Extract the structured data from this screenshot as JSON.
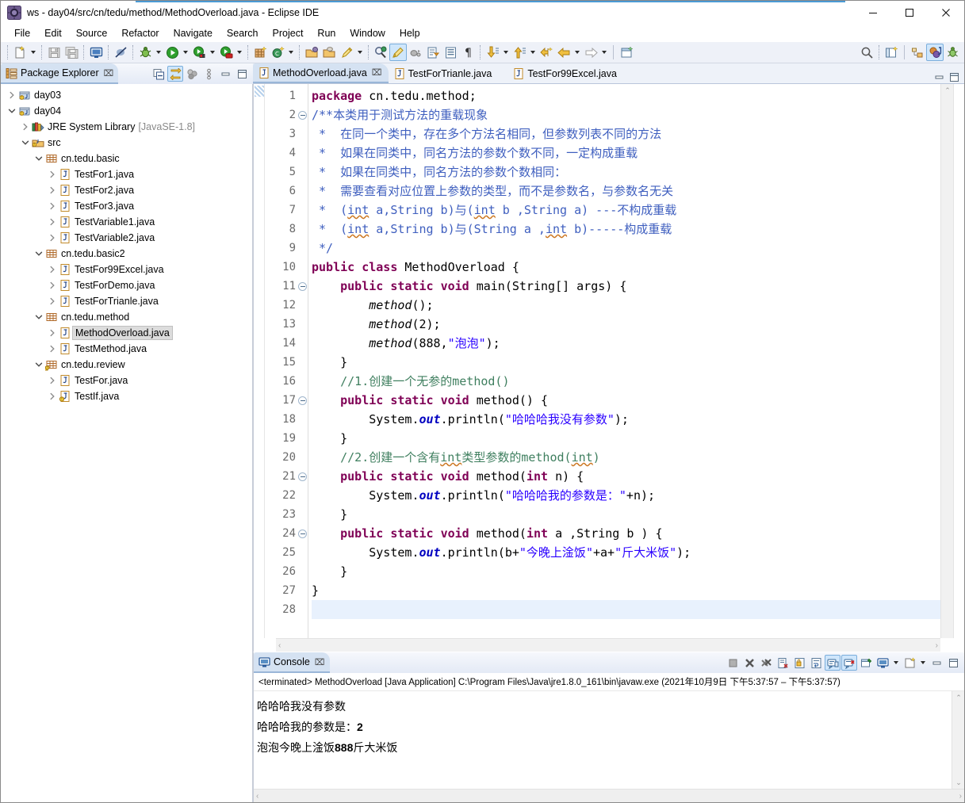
{
  "window": {
    "title": "ws - day04/src/cn/tedu/method/MethodOverload.java - Eclipse IDE",
    "app_icon": "eclipse-icon",
    "minimize_label": "—",
    "maximize_label": "□",
    "close_label": "✕",
    "accent_color": "#4a9ad4"
  },
  "menubar": {
    "items": [
      {
        "label": "File"
      },
      {
        "label": "Edit"
      },
      {
        "label": "Source"
      },
      {
        "label": "Refactor"
      },
      {
        "label": "Navigate"
      },
      {
        "label": "Search"
      },
      {
        "label": "Project"
      },
      {
        "label": "Run"
      },
      {
        "label": "Window"
      },
      {
        "label": "Help"
      }
    ]
  },
  "toolbar": {
    "groups": [
      {
        "items": [
          {
            "icon": "new-wizard-icon",
            "dropdown": true
          },
          {
            "icon": "save-icon",
            "dropdown": false
          },
          {
            "icon": "save-all-icon",
            "dropdown": false
          }
        ]
      },
      {
        "items": [
          {
            "icon": "print-icon",
            "dropdown": false
          }
        ]
      },
      {
        "items": [
          {
            "icon": "toggle-breakpoint-icon",
            "dropdown": false
          }
        ]
      },
      {
        "items": [
          {
            "icon": "debug-icon",
            "dropdown": true
          },
          {
            "icon": "run-icon",
            "dropdown": true
          },
          {
            "icon": "run-external-tools-icon",
            "dropdown": true
          },
          {
            "icon": "coverage-icon",
            "dropdown": true
          }
        ]
      },
      {
        "items": [
          {
            "icon": "new-java-package-icon",
            "dropdown": false
          },
          {
            "icon": "new-java-class-icon",
            "dropdown": true
          }
        ]
      },
      {
        "items": [
          {
            "icon": "open-type-icon",
            "dropdown": false
          },
          {
            "icon": "open-task-icon",
            "dropdown": false
          },
          {
            "icon": "quick-fix-icon",
            "dropdown": true
          }
        ]
      },
      {
        "items": [
          {
            "icon": "search-type-icon",
            "dropdown": false
          },
          {
            "icon": "highlight-marker-icon",
            "dropdown": false,
            "selected": true
          },
          {
            "icon": "skip-breakpoints-icon",
            "dropdown": false
          },
          {
            "icon": "new-annotation-icon",
            "dropdown": false
          },
          {
            "icon": "show-whitespace-icon",
            "dropdown": false
          },
          {
            "icon": "pilcrow-icon",
            "dropdown": false
          }
        ]
      },
      {
        "items": [
          {
            "icon": "next-annotation-icon",
            "dropdown": true
          },
          {
            "icon": "previous-annotation-icon",
            "dropdown": true
          },
          {
            "icon": "back-history-icon",
            "dropdown": false
          },
          {
            "icon": "back-arrow-icon",
            "dropdown": true
          },
          {
            "icon": "forward-arrow-icon",
            "dropdown": true
          }
        ]
      },
      {
        "items": [
          {
            "icon": "new-editor-icon",
            "dropdown": false
          }
        ]
      }
    ],
    "right_items": [
      {
        "icon": "search-icon"
      },
      {
        "icon": "open-perspective-icon"
      },
      {
        "icon": "java-browsing-perspective-icon"
      },
      {
        "icon": "java-perspective-icon",
        "selected": true
      },
      {
        "icon": "debug-perspective-icon"
      }
    ]
  },
  "package_explorer": {
    "title": "Package Explorer",
    "tab_icon": "package-explorer-icon",
    "close_icon": "⌧",
    "tools": [
      {
        "icon": "collapse-all-icon",
        "selected": false
      },
      {
        "icon": "link-with-editor-icon",
        "selected": true
      },
      {
        "icon": "view-menu-dots-icon",
        "selected": false
      },
      {
        "icon": "view-menu-icon",
        "selected": false
      },
      {
        "icon": "minimize-view-icon",
        "selected": false
      },
      {
        "icon": "maximize-view-icon",
        "selected": false
      }
    ],
    "tree": [
      {
        "label": "day03",
        "indent": 0,
        "icon": "java-project-icon",
        "twisty": "collapsed",
        "selected": false
      },
      {
        "label": "day04",
        "indent": 0,
        "icon": "java-project-icon",
        "twisty": "expanded",
        "selected": false
      },
      {
        "label": "JRE System Library",
        "indent": 1,
        "icon": "jre-library-icon",
        "twisty": "collapsed",
        "selected": false,
        "note": "[JavaSE-1.8]"
      },
      {
        "label": "src",
        "indent": 1,
        "icon": "source-folder-icon",
        "twisty": "expanded",
        "selected": false
      },
      {
        "label": "cn.tedu.basic",
        "indent": 2,
        "icon": "package-icon",
        "twisty": "expanded",
        "selected": false
      },
      {
        "label": "TestFor1.java",
        "indent": 3,
        "icon": "java-file-icon",
        "twisty": "collapsed",
        "selected": false
      },
      {
        "label": "TestFor2.java",
        "indent": 3,
        "icon": "java-file-icon",
        "twisty": "collapsed",
        "selected": false
      },
      {
        "label": "TestFor3.java",
        "indent": 3,
        "icon": "java-file-icon",
        "twisty": "collapsed",
        "selected": false
      },
      {
        "label": "TestVariable1.java",
        "indent": 3,
        "icon": "java-file-icon",
        "twisty": "collapsed",
        "selected": false
      },
      {
        "label": "TestVariable2.java",
        "indent": 3,
        "icon": "java-file-icon",
        "twisty": "collapsed",
        "selected": false
      },
      {
        "label": "cn.tedu.basic2",
        "indent": 2,
        "icon": "package-icon",
        "twisty": "expanded",
        "selected": false
      },
      {
        "label": "TestFor99Excel.java",
        "indent": 3,
        "icon": "java-file-icon",
        "twisty": "collapsed",
        "selected": false
      },
      {
        "label": "TestForDemo.java",
        "indent": 3,
        "icon": "java-file-icon",
        "twisty": "collapsed",
        "selected": false
      },
      {
        "label": "TestForTrianle.java",
        "indent": 3,
        "icon": "java-file-icon",
        "twisty": "collapsed",
        "selected": false
      },
      {
        "label": "cn.tedu.method",
        "indent": 2,
        "icon": "package-icon",
        "twisty": "expanded",
        "selected": false
      },
      {
        "label": "MethodOverload.java",
        "indent": 3,
        "icon": "java-file-icon",
        "twisty": "collapsed",
        "selected": true
      },
      {
        "label": "TestMethod.java",
        "indent": 3,
        "icon": "java-file-icon",
        "twisty": "collapsed",
        "selected": false
      },
      {
        "label": "cn.tedu.review",
        "indent": 2,
        "icon": "package-warning-icon",
        "twisty": "expanded",
        "selected": false
      },
      {
        "label": "TestFor.java",
        "indent": 3,
        "icon": "java-file-icon",
        "twisty": "collapsed",
        "selected": false
      },
      {
        "label": "TestIf.java",
        "indent": 3,
        "icon": "java-file-warning-icon",
        "twisty": "collapsed",
        "selected": false
      }
    ]
  },
  "editor": {
    "tabs": [
      {
        "label": "MethodOverload.java",
        "active": true,
        "icon": "java-file-icon",
        "close_icon": "⌧"
      },
      {
        "label": "TestForTrianle.java",
        "active": false,
        "icon": "java-file-icon"
      },
      {
        "label": "TestFor99Excel.java",
        "active": false,
        "icon": "java-file-icon"
      }
    ],
    "tools": [
      {
        "icon": "minimize-editor-icon"
      },
      {
        "icon": "maximize-editor-icon"
      }
    ],
    "current_line": 28,
    "total_lines": 28,
    "lines": [
      {
        "n": 1,
        "fold": false
      },
      {
        "n": 2,
        "fold": true
      },
      {
        "n": 3,
        "fold": false
      },
      {
        "n": 4,
        "fold": false
      },
      {
        "n": 5,
        "fold": false
      },
      {
        "n": 6,
        "fold": false
      },
      {
        "n": 7,
        "fold": false
      },
      {
        "n": 8,
        "fold": false
      },
      {
        "n": 9,
        "fold": false
      },
      {
        "n": 10,
        "fold": false
      },
      {
        "n": 11,
        "fold": true
      },
      {
        "n": 12,
        "fold": false
      },
      {
        "n": 13,
        "fold": false
      },
      {
        "n": 14,
        "fold": false
      },
      {
        "n": 15,
        "fold": false
      },
      {
        "n": 16,
        "fold": false
      },
      {
        "n": 17,
        "fold": true
      },
      {
        "n": 18,
        "fold": false
      },
      {
        "n": 19,
        "fold": false
      },
      {
        "n": 20,
        "fold": false
      },
      {
        "n": 21,
        "fold": true
      },
      {
        "n": 22,
        "fold": false
      },
      {
        "n": 23,
        "fold": false
      },
      {
        "n": 24,
        "fold": true
      },
      {
        "n": 25,
        "fold": false
      },
      {
        "n": 26,
        "fold": false
      },
      {
        "n": 27,
        "fold": false
      },
      {
        "n": 28,
        "fold": false
      }
    ],
    "source_text": [
      "package cn.tedu.method;",
      "/**本类用于测试方法的重载现象",
      " *  在同一个类中，存在多个方法名相同，但参数列表不同的方法",
      " *  如果在同类中，同名方法的参数个数不同，一定构成重载",
      " *  如果在同类中，同名方法的参数个数相同：",
      " *  需要查看对应位置上参数的类型，而不是参数名，与参数名无关",
      " *  (int a,String b)与(int b ,String a) ---不构成重载",
      " *  (int a,String b)与(String a ,int b)-----构成重载",
      " */",
      "public class MethodOverload {",
      "    public static void main(String[] args) {",
      "        method();",
      "        method(2);",
      "        method(888,\"泡泡\");",
      "    }",
      "    //1.创建一个无参的method()",
      "    public static void method() {",
      "        System.out.println(\"哈哈哈我没有参数\");",
      "    }",
      "    //2.创建一个含有int类型参数的method(int)",
      "    public static void method(int n) {",
      "        System.out.println(\"哈哈哈我的参数是：\"+n);",
      "    }",
      "    public static void method(int a ,String b ) {",
      "        System.out.println(b+\"今晚上淦饭\"+a+\"斤大米饭\");",
      "    }",
      "}",
      ""
    ],
    "scroll_left_arrow": "‹",
    "scroll_right_arrow": "›",
    "scroll_up_arrow": "⌃"
  },
  "console": {
    "title": "Console",
    "tab_icon": "console-icon",
    "close_icon": "⌧",
    "tools": [
      {
        "icon": "terminate-icon",
        "selected": false
      },
      {
        "icon": "remove-launch-icon",
        "selected": false
      },
      {
        "icon": "remove-all-terminated-icon",
        "selected": false
      },
      {
        "icon": "clear-console-icon",
        "selected": false
      },
      {
        "icon": "scroll-lock-icon",
        "selected": false
      },
      {
        "icon": "word-wrap-icon",
        "selected": false
      },
      {
        "icon": "show-console-on-output-icon",
        "selected": true
      },
      {
        "icon": "show-console-on-error-icon",
        "selected": true
      },
      {
        "icon": "pin-console-icon",
        "selected": false
      },
      {
        "icon": "display-selected-console-icon",
        "selected": false,
        "dropdown": true
      },
      {
        "icon": "open-console-icon",
        "selected": false,
        "dropdown": true
      },
      {
        "icon": "minimize-console-icon",
        "selected": false
      },
      {
        "icon": "maximize-console-icon",
        "selected": false
      }
    ],
    "status_line": "<terminated> MethodOverload [Java Application] C:\\Program Files\\Java\\jre1.8.0_161\\bin\\javaw.exe  (2021年10月9日 下午5:37:57 – 下午5:37:57)",
    "output": [
      "哈哈哈我没有参数",
      "哈哈哈我的参数是：2",
      "泡泡今晚上淦饭888斤大米饭"
    ],
    "scroll_left_arrow": "‹",
    "scroll_right_arrow": "›",
    "scroll_up_arrow": "⌃",
    "scroll_down_arrow": "⌄"
  }
}
